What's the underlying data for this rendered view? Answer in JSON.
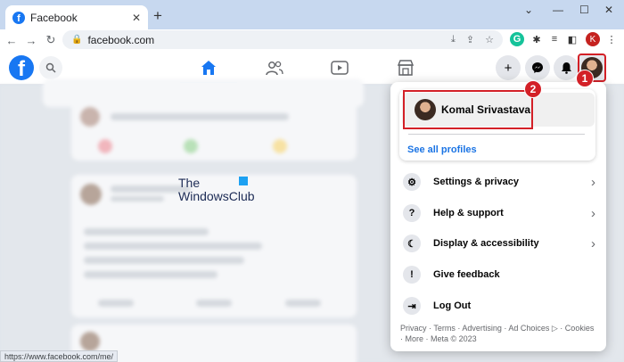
{
  "browser": {
    "tab_title": "Facebook",
    "tab_favicon": "f",
    "close_tab": "✕",
    "new_tab": "+",
    "minimize": "⌄",
    "min": "—",
    "restore": "☐",
    "close": "✕",
    "url": "facebook.com",
    "profile_initial": "K",
    "status_url": "https://www.facebook.com/me/"
  },
  "facebook": {
    "logo": "f"
  },
  "menu": {
    "profile_name": "Komal Srivastava",
    "see_all": "See all profiles",
    "items": [
      {
        "label": "Settings & privacy",
        "icon": "gear-icon",
        "has_chevron": true
      },
      {
        "label": "Help & support",
        "icon": "question-icon",
        "has_chevron": true
      },
      {
        "label": "Display & accessibility",
        "icon": "moon-icon",
        "has_chevron": true
      },
      {
        "label": "Give feedback",
        "icon": "feedback-icon",
        "has_chevron": false
      },
      {
        "label": "Log Out",
        "icon": "logout-icon",
        "has_chevron": false
      }
    ],
    "footer": "Privacy · Terms · Advertising · Ad Choices ▷ · Cookies · More · Meta © 2023"
  },
  "annotations": {
    "badge_1": "1",
    "badge_2": "2"
  },
  "watermark": {
    "line1": "The",
    "line2": "WindowsClub"
  },
  "colors": {
    "fb_blue": "#1877f2",
    "highlight_red": "#d32027"
  }
}
